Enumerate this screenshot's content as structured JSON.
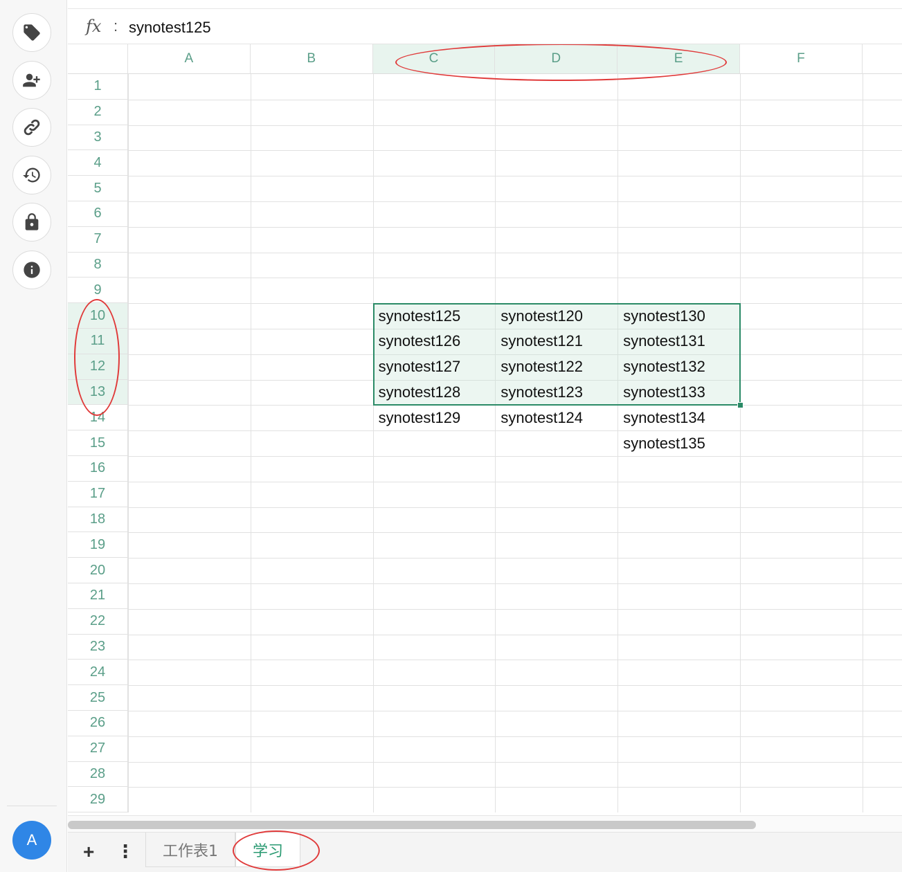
{
  "sidebar": {
    "buttons": [
      {
        "icon": "tag-icon"
      },
      {
        "icon": "add-user-icon"
      },
      {
        "icon": "link-icon"
      },
      {
        "icon": "history-icon"
      },
      {
        "icon": "lock-icon"
      },
      {
        "icon": "info-icon"
      }
    ],
    "avatar_letter": "A"
  },
  "formula_bar": {
    "fx_label": "fx",
    "colon": ":",
    "value": "synotest125"
  },
  "grid": {
    "columns": [
      "A",
      "B",
      "C",
      "D",
      "E",
      "F"
    ],
    "selected_columns": [
      "C",
      "D",
      "E"
    ],
    "rows": [
      "1",
      "2",
      "3",
      "4",
      "5",
      "6",
      "7",
      "8",
      "9",
      "10",
      "11",
      "12",
      "13",
      "14",
      "15",
      "16",
      "17",
      "18",
      "19",
      "20",
      "21",
      "22",
      "23",
      "24",
      "25",
      "26",
      "27",
      "28",
      "29"
    ],
    "selected_rows": [
      "10",
      "11",
      "12",
      "13"
    ],
    "cells": [
      {
        "ref": "C10",
        "value": "synotest125"
      },
      {
        "ref": "D10",
        "value": "synotest120"
      },
      {
        "ref": "E10",
        "value": "synotest130"
      },
      {
        "ref": "C11",
        "value": "synotest126"
      },
      {
        "ref": "D11",
        "value": "synotest121"
      },
      {
        "ref": "E11",
        "value": "synotest131"
      },
      {
        "ref": "C12",
        "value": "synotest127"
      },
      {
        "ref": "D12",
        "value": "synotest122"
      },
      {
        "ref": "E12",
        "value": "synotest132"
      },
      {
        "ref": "C13",
        "value": "synotest128"
      },
      {
        "ref": "D13",
        "value": "synotest123"
      },
      {
        "ref": "E13",
        "value": "synotest133"
      },
      {
        "ref": "C14",
        "value": "synotest129"
      },
      {
        "ref": "D14",
        "value": "synotest124"
      },
      {
        "ref": "E14",
        "value": "synotest134"
      },
      {
        "ref": "E15",
        "value": "synotest135"
      }
    ],
    "selection": "C10:E13",
    "accent_color": "#2a8a66",
    "header_text_color": "#5a9e88"
  },
  "sheet_tabs": {
    "add_label": "+",
    "menu_label": "⋮",
    "tabs": [
      {
        "label": "工作表1",
        "active": false
      },
      {
        "label": "学习",
        "active": true
      }
    ]
  },
  "annotation_color": "#e03a3a"
}
